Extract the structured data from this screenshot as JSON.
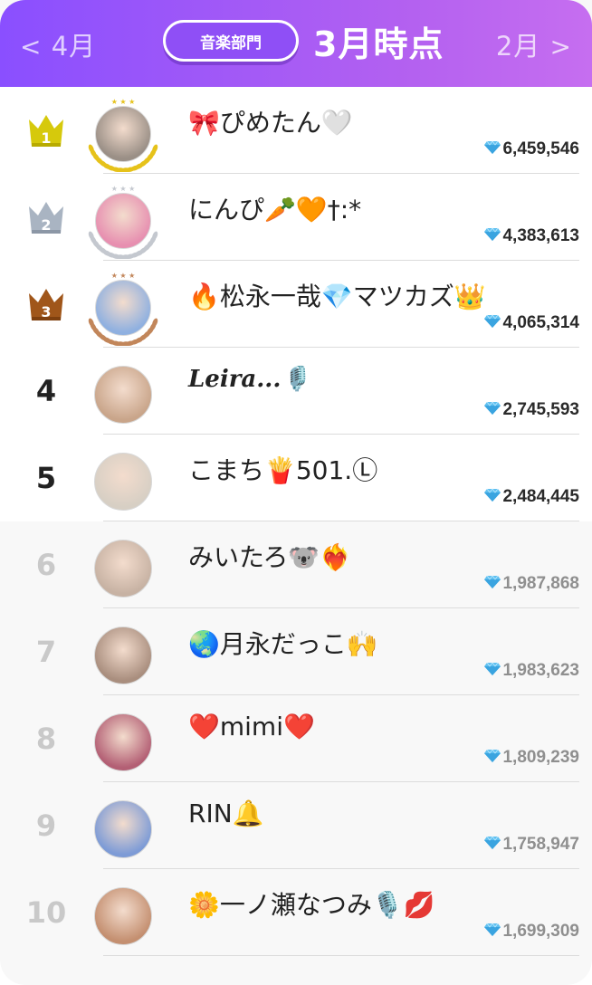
{
  "header": {
    "prev_label": "4月",
    "prev_chevron": "<",
    "next_label": "2月",
    "next_chevron": ">",
    "category_label": "音楽部門",
    "period_title": "3月時点",
    "gradient_start": "#8a4fff",
    "gradient_end": "#c66ef0"
  },
  "rankings": [
    {
      "rank": "1",
      "name": "🎀ぴめたん🤍",
      "score": "6,459,546",
      "badge": "gold-crown",
      "avatar_color": "#9a8f86"
    },
    {
      "rank": "2",
      "name": "にんぴ🥕🧡†:*",
      "score": "4,383,613",
      "badge": "silver-crown",
      "avatar_color": "#e78fb0"
    },
    {
      "rank": "3",
      "name": "🔥松永一哉💎マツカズ👑",
      "score": "4,065,314",
      "badge": "bronze-crown",
      "avatar_color": "#8fb0e0"
    },
    {
      "rank": "4",
      "name": "Leira...🎙️",
      "score": "2,745,593",
      "badge": "none",
      "avatar_color": "#c9a58a"
    },
    {
      "rank": "5",
      "name": "こまち🍟501.Ⓛ",
      "score": "2,484,445",
      "badge": "none",
      "avatar_color": "#d7cfc4"
    },
    {
      "rank": "6",
      "name": "みいたろ🐨❤️‍🔥",
      "score": "1,987,868",
      "badge": "none",
      "avatar_color": "#c7b2a3"
    },
    {
      "rank": "7",
      "name": "🌏月永だっこ🙌",
      "score": "1,983,623",
      "badge": "none",
      "avatar_color": "#a98e7e"
    },
    {
      "rank": "8",
      "name": "❤️mimi❤️",
      "score": "1,809,239",
      "badge": "none",
      "avatar_color": "#b35f74"
    },
    {
      "rank": "9",
      "name": "RIN🔔",
      "score": "1,758,947",
      "badge": "none",
      "avatar_color": "#7d9bd6"
    },
    {
      "rank": "10",
      "name": "🌼一ノ瀬なつみ🎙️💋",
      "score": "1,699,309",
      "badge": "none",
      "avatar_color": "#c48f70"
    }
  ],
  "score_icon": "diamond-icon"
}
